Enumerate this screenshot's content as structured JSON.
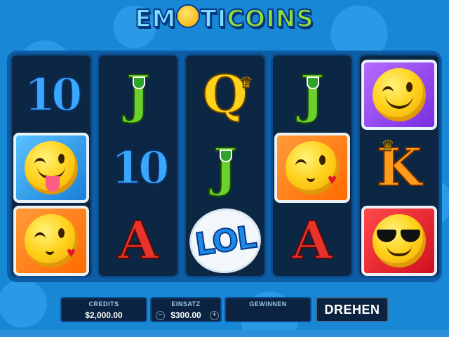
{
  "logo": {
    "part1": "EM",
    "part2": "TI",
    "part3": "COINS"
  },
  "reels": [
    [
      {
        "type": "letter",
        "kind": "10",
        "label": "10"
      },
      {
        "type": "emoji",
        "kind": "tongue",
        "bg": "blue"
      },
      {
        "type": "emoji",
        "kind": "kiss",
        "bg": "orange"
      }
    ],
    [
      {
        "type": "letter",
        "kind": "J",
        "label": "J"
      },
      {
        "type": "letter",
        "kind": "10",
        "label": "10"
      },
      {
        "type": "letter",
        "kind": "A",
        "label": "A"
      }
    ],
    [
      {
        "type": "letter",
        "kind": "Q",
        "label": "Q"
      },
      {
        "type": "letter",
        "kind": "J",
        "label": "J"
      },
      {
        "type": "lol",
        "label": "LOL"
      }
    ],
    [
      {
        "type": "letter",
        "kind": "J",
        "label": "J"
      },
      {
        "type": "emoji",
        "kind": "kiss",
        "bg": "orange"
      },
      {
        "type": "letter",
        "kind": "A",
        "label": "A"
      }
    ],
    [
      {
        "type": "emoji",
        "kind": "wink",
        "bg": "purple"
      },
      {
        "type": "letter",
        "kind": "K",
        "label": "K"
      },
      {
        "type": "emoji",
        "kind": "sunglasses",
        "bg": "red"
      }
    ]
  ],
  "controls": {
    "credits_label": "CREDITS",
    "credits_value": "$2,000.00",
    "bet_label": "EINSATZ",
    "bet_value": "$300.00",
    "minus": "−",
    "plus": "+",
    "win_label": "GEWINNEN",
    "win_value": "",
    "spin_label": "DREHEN"
  }
}
